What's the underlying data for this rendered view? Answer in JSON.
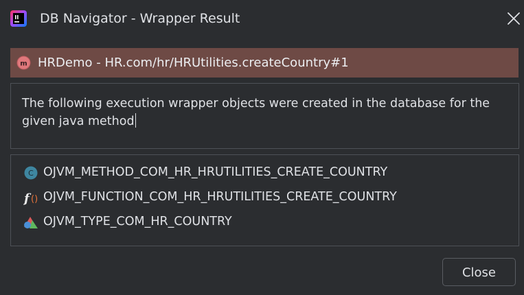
{
  "window": {
    "title": "DB Navigator - Wrapper Result",
    "app_icon": "intellij-logo-icon",
    "close_icon": "close-icon"
  },
  "header": {
    "icon": "java-method-icon",
    "text": "HRDemo - HR.com/hr/HRUtilities.createCountry#1",
    "background": "#6e4a45"
  },
  "message": {
    "text": "The following execution wrapper objects were created in the database for the given java method"
  },
  "objects": [
    {
      "icon": "type-body-icon",
      "name": "OJVM_METHOD_COM_HR_HRUTILITIES_CREATE_COUNTRY"
    },
    {
      "icon": "function-icon",
      "name": "OJVM_FUNCTION_COM_HR_HRUTILITIES_CREATE_COUNTRY"
    },
    {
      "icon": "type-icon",
      "name": "OJVM_TYPE_COM_HR_COUNTRY"
    }
  ],
  "footer": {
    "close_label": "Close"
  }
}
